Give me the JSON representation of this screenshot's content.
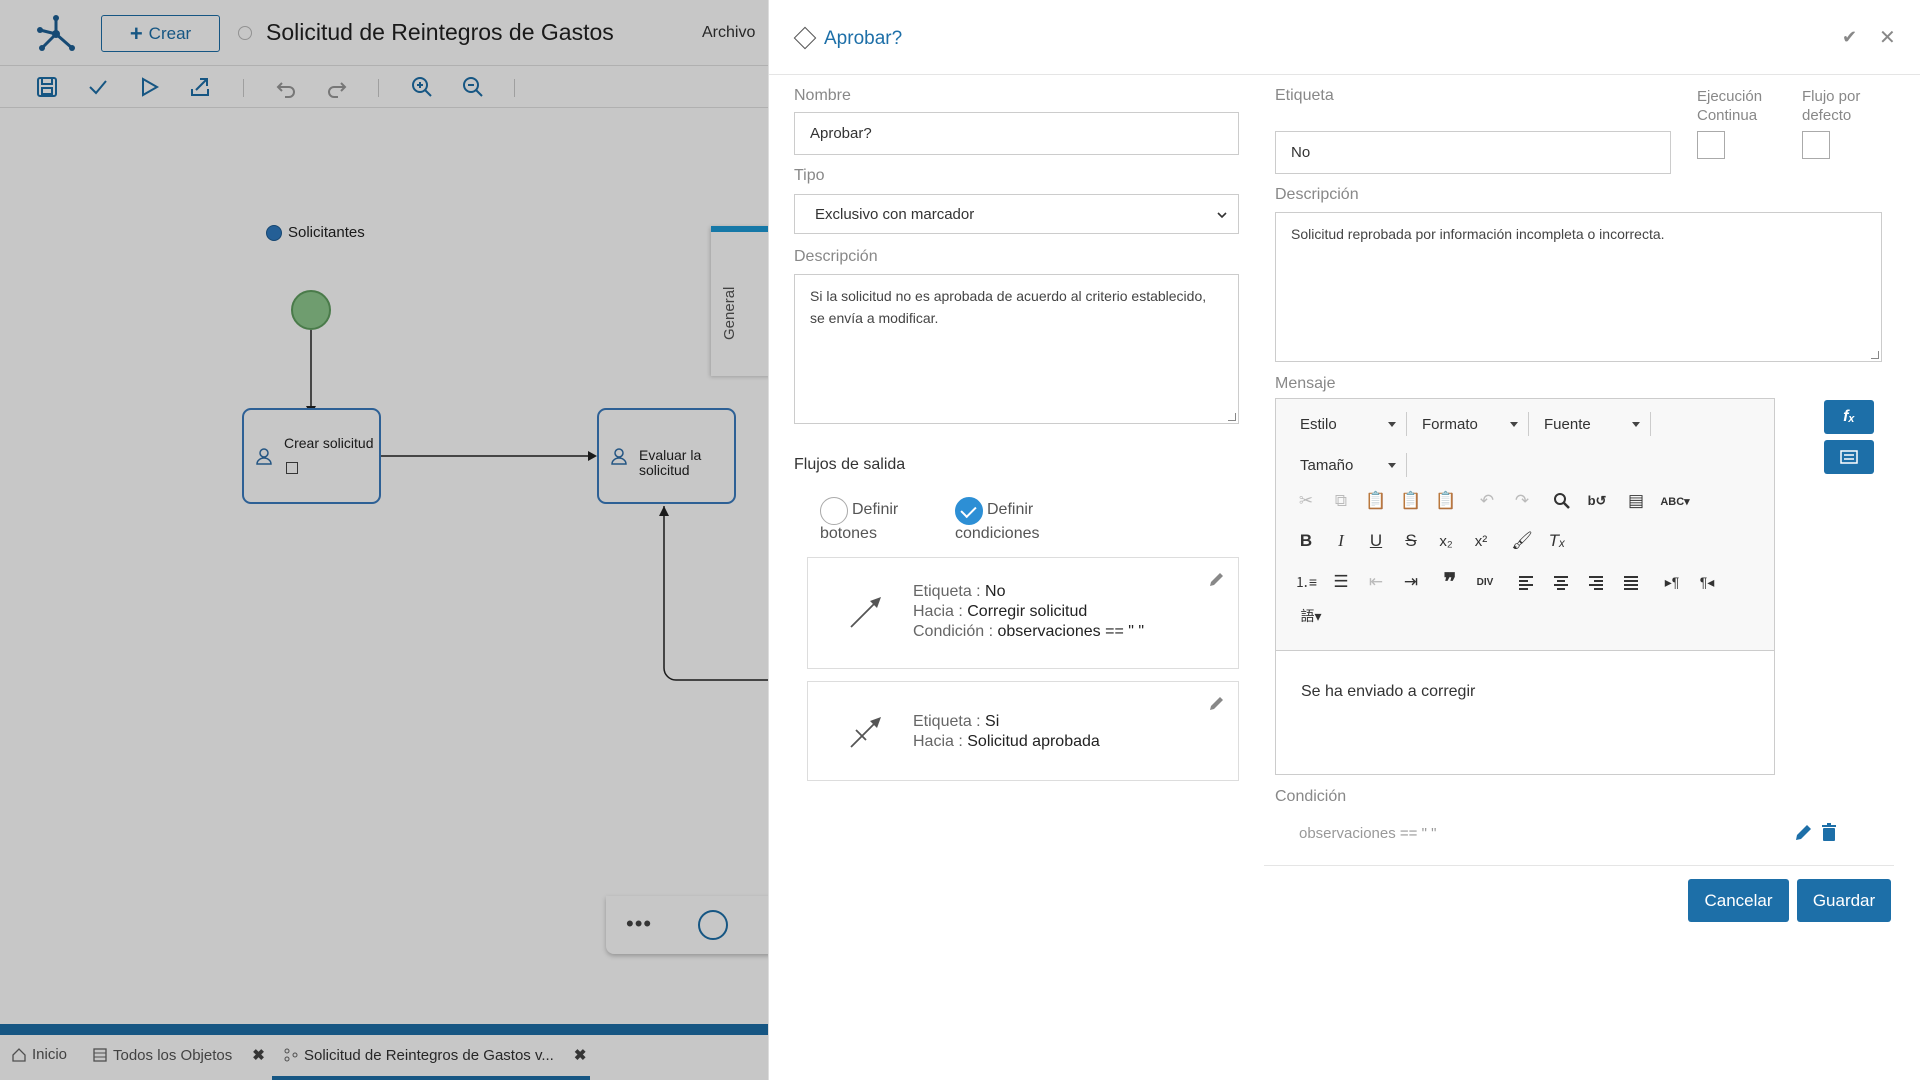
{
  "app": {
    "create_label": "Crear",
    "title": "Solicitud de Reintegros de Gastos",
    "menu_archivo": "Archivo"
  },
  "diagram": {
    "lane": "Solicitantes",
    "task1": "Crear solicitud",
    "task2_line1": "Evaluar la",
    "task2_line2": "solicitud",
    "side_tab": "General"
  },
  "bottom_tabs": {
    "home": "Inicio",
    "all_objects": "Todos los Objetos",
    "active": "Solicitud de Reintegros de Gastos v..."
  },
  "panel": {
    "title": "Aprobar?",
    "left": {
      "nombre_label": "Nombre",
      "nombre_value": "Aprobar?",
      "tipo_label": "Tipo",
      "tipo_value": "Exclusivo con marcador",
      "descripcion_label": "Descripción",
      "descripcion_value": "Si la solicitud no es aprobada de acuerdo al criterio establecido, se envía a modificar.",
      "flows_title": "Flujos de salida",
      "radio_buttons_l1": "Definir",
      "radio_buttons_l2": "botones",
      "radio_conditions_l1": "Definir",
      "radio_conditions_l2": "condiciones",
      "flows": [
        {
          "etiqueta_label": "Etiqueta : ",
          "etiqueta": "No",
          "hacia_label": "Hacia : ",
          "hacia": "Corregir solicitud",
          "condicion_label": "Condición : ",
          "condicion": "observaciones == \" \""
        },
        {
          "etiqueta_label": "Etiqueta : ",
          "etiqueta": "Si",
          "hacia_label": "Hacia : ",
          "hacia": "Solicitud aprobada"
        }
      ]
    },
    "right": {
      "etiqueta_label": "Etiqueta",
      "etiqueta_value": "No",
      "ejecucion_l1": "Ejecución",
      "ejecucion_l2": "Continua",
      "flujo_l1": "Flujo por",
      "flujo_l2": "defecto",
      "descripcion_label": "Descripción",
      "descripcion_value": "Solicitud reprobada por información incompleta o incorrecta.",
      "mensaje_label": "Mensaje",
      "editor": {
        "estilo": "Estilo",
        "formato": "Formato",
        "fuente": "Fuente",
        "tamano": "Tamaño",
        "content": "Se ha enviado a corregir"
      },
      "condicion_label": "Condición",
      "condicion_value": "observaciones == \" \"",
      "cancel": "Cancelar",
      "save": "Guardar"
    }
  },
  "colors": {
    "accent": "#1d6fa8",
    "start_event": "#8fc98f",
    "radio_on": "#2d8fd5"
  }
}
